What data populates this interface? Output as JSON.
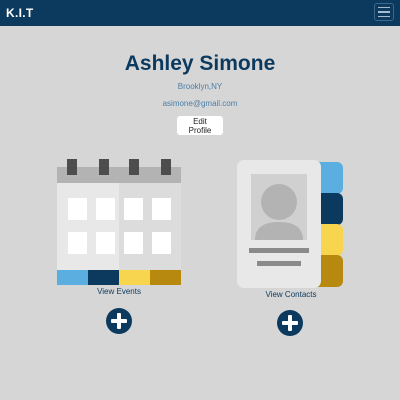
{
  "navbar": {
    "brand": "K.I.T",
    "menu_icon": "hamburger-menu-icon"
  },
  "profile": {
    "name": "Ashley Simone",
    "location": "Brooklyn,NY",
    "email": "asimone@gmail.com",
    "edit_label": "Edit Profile"
  },
  "events": {
    "label": "View Events",
    "icon": "calendar-icon",
    "add_icon": "plus-icon"
  },
  "contacts": {
    "label": "View Contacts",
    "icon": "contact-book-icon",
    "add_icon": "plus-icon"
  },
  "colors": {
    "navy": "#0b3a5e",
    "sky": "#5aaee0",
    "yellow": "#f8d54f",
    "gold": "#b8890f",
    "background": "#d6d6d6"
  }
}
